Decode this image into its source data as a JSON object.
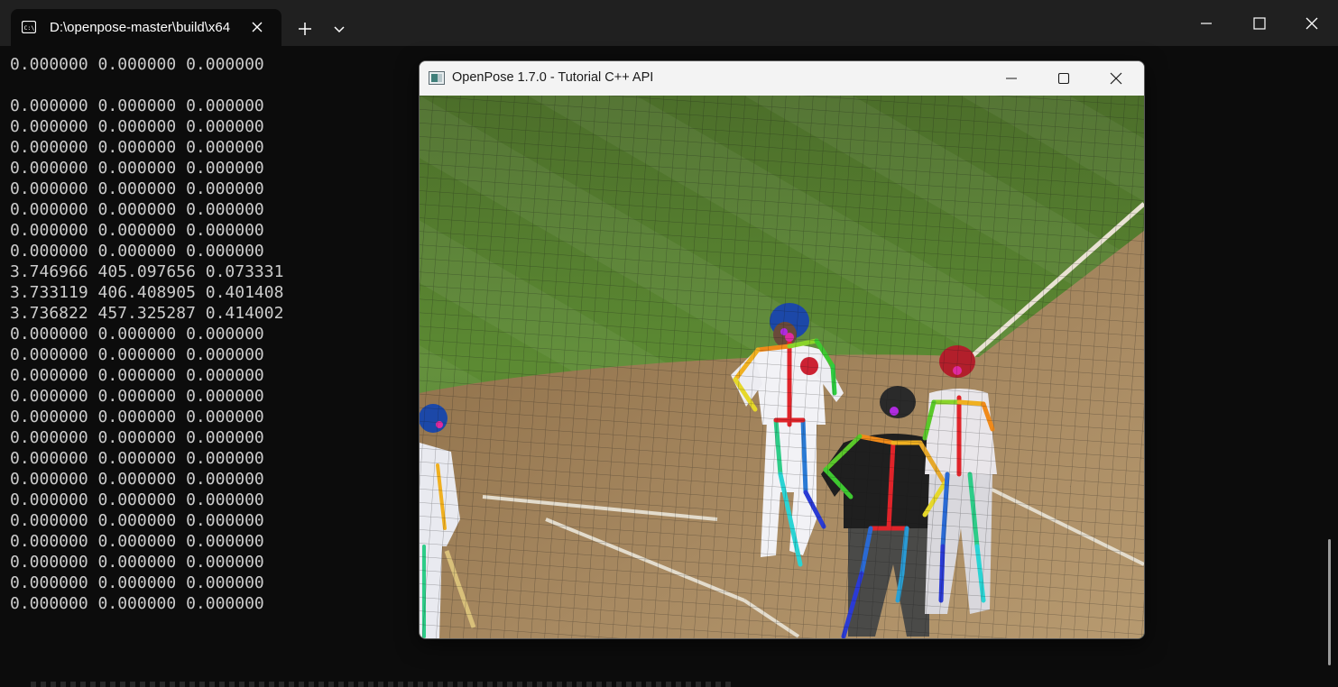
{
  "terminal": {
    "tab_title": "D:\\openpose-master\\build\\x64",
    "tab_icon": "terminal-icon",
    "new_tab_symbol": "+",
    "lines": [
      "0.000000 0.000000 0.000000",
      "",
      "0.000000 0.000000 0.000000",
      "0.000000 0.000000 0.000000",
      "0.000000 0.000000 0.000000",
      "0.000000 0.000000 0.000000",
      "0.000000 0.000000 0.000000",
      "0.000000 0.000000 0.000000",
      "0.000000 0.000000 0.000000",
      "0.000000 0.000000 0.000000",
      "3.746966 405.097656 0.073331",
      "3.733119 406.408905 0.401408",
      "3.736822 457.325287 0.414002",
      "0.000000 0.000000 0.000000",
      "0.000000 0.000000 0.000000",
      "0.000000 0.000000 0.000000",
      "0.000000 0.000000 0.000000",
      "0.000000 0.000000 0.000000",
      "0.000000 0.000000 0.000000",
      "0.000000 0.000000 0.000000",
      "0.000000 0.000000 0.000000",
      "0.000000 0.000000 0.000000",
      "0.000000 0.000000 0.000000",
      "0.000000 0.000000 0.000000",
      "0.000000 0.000000 0.000000",
      "0.000000 0.000000 0.000000",
      "0.000000 0.000000 0.000000"
    ]
  },
  "openpose_window": {
    "title": "OpenPose 1.7.0 - Tutorial C++ API",
    "icon": "opencv-window-icon"
  },
  "colors": {
    "terminal_bg": "#0c0c0c",
    "titlebar_bg": "#202020",
    "console_text": "#cccccc",
    "grass": "#4f7a2c",
    "dirt": "#a98a5e"
  }
}
